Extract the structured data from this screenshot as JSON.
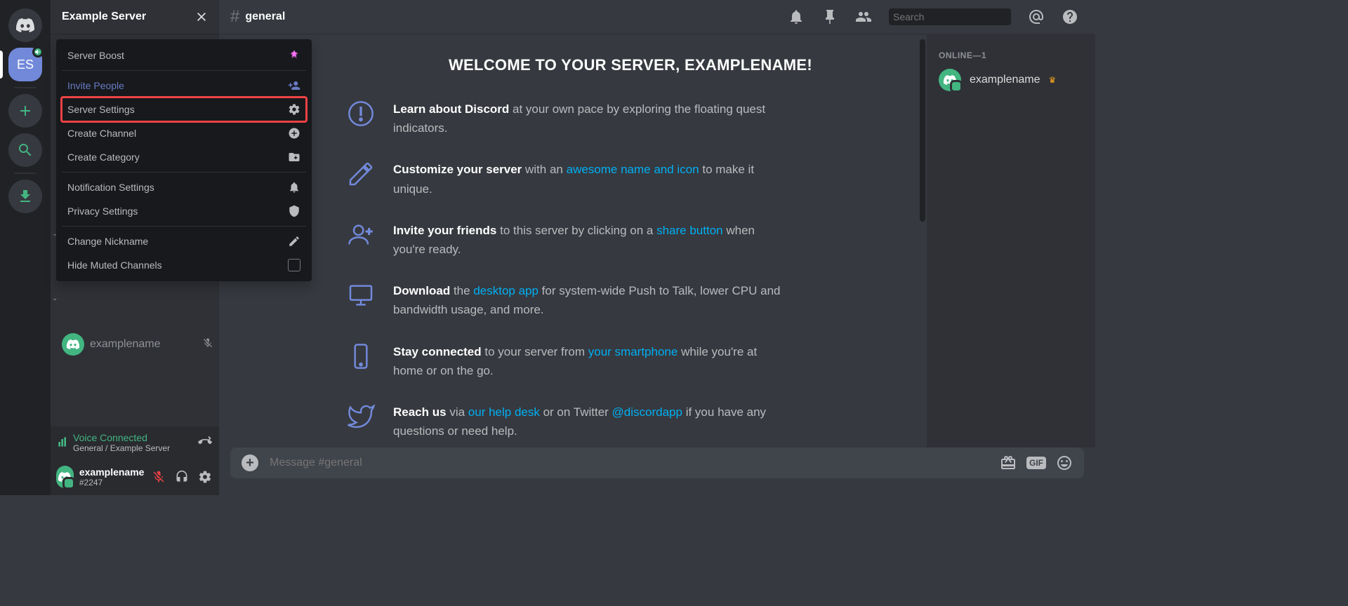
{
  "server": {
    "name": "Example Server",
    "initials": "ES"
  },
  "channel": {
    "name": "general"
  },
  "dropdown": {
    "boost": "Server Boost",
    "invite": "Invite People",
    "settings": "Server Settings",
    "create_channel": "Create Channel",
    "create_category": "Create Category",
    "notifications": "Notification Settings",
    "privacy": "Privacy Settings",
    "nickname": "Change Nickname",
    "hide_muted": "Hide Muted Channels"
  },
  "voice": {
    "status": "Voice Connected",
    "channel": "General / Example Server"
  },
  "user": {
    "name": "examplename",
    "tag": "#2247"
  },
  "voice_user": "examplename",
  "welcome": {
    "title": "WELCOME TO YOUR SERVER, EXAMPLENAME!",
    "tips": [
      {
        "bold": "Learn about Discord",
        "rest": " at your own pace by exploring the floating quest indicators."
      },
      {
        "bold": "Customize your server",
        "rest_before": " with an ",
        "link": "awesome name and icon",
        "rest_after": " to make it unique."
      },
      {
        "bold": "Invite your friends",
        "rest_before": " to this server by clicking on a ",
        "link": "share button",
        "rest_after": " when you're ready."
      },
      {
        "bold": "Download",
        "rest_before": " the ",
        "link": "desktop app",
        "rest_after": " for system-wide Push to Talk, lower CPU and bandwidth usage, and more."
      },
      {
        "bold": "Stay connected",
        "rest_before": " to your server from ",
        "link": "your smartphone",
        "rest_after": " while you're at home or on the go."
      },
      {
        "bold": "Reach us",
        "rest_before": " via ",
        "link": "our help desk",
        "rest_mid": " or on Twitter ",
        "link2": "@discordapp",
        "rest_after": " if you have any questions or need help."
      }
    ]
  },
  "search_placeholder": "Search",
  "input_placeholder": "Message #general",
  "gif_label": "GIF",
  "members": {
    "header": "ONLINE—1",
    "list": [
      {
        "name": "examplename",
        "owner": true
      }
    ]
  }
}
